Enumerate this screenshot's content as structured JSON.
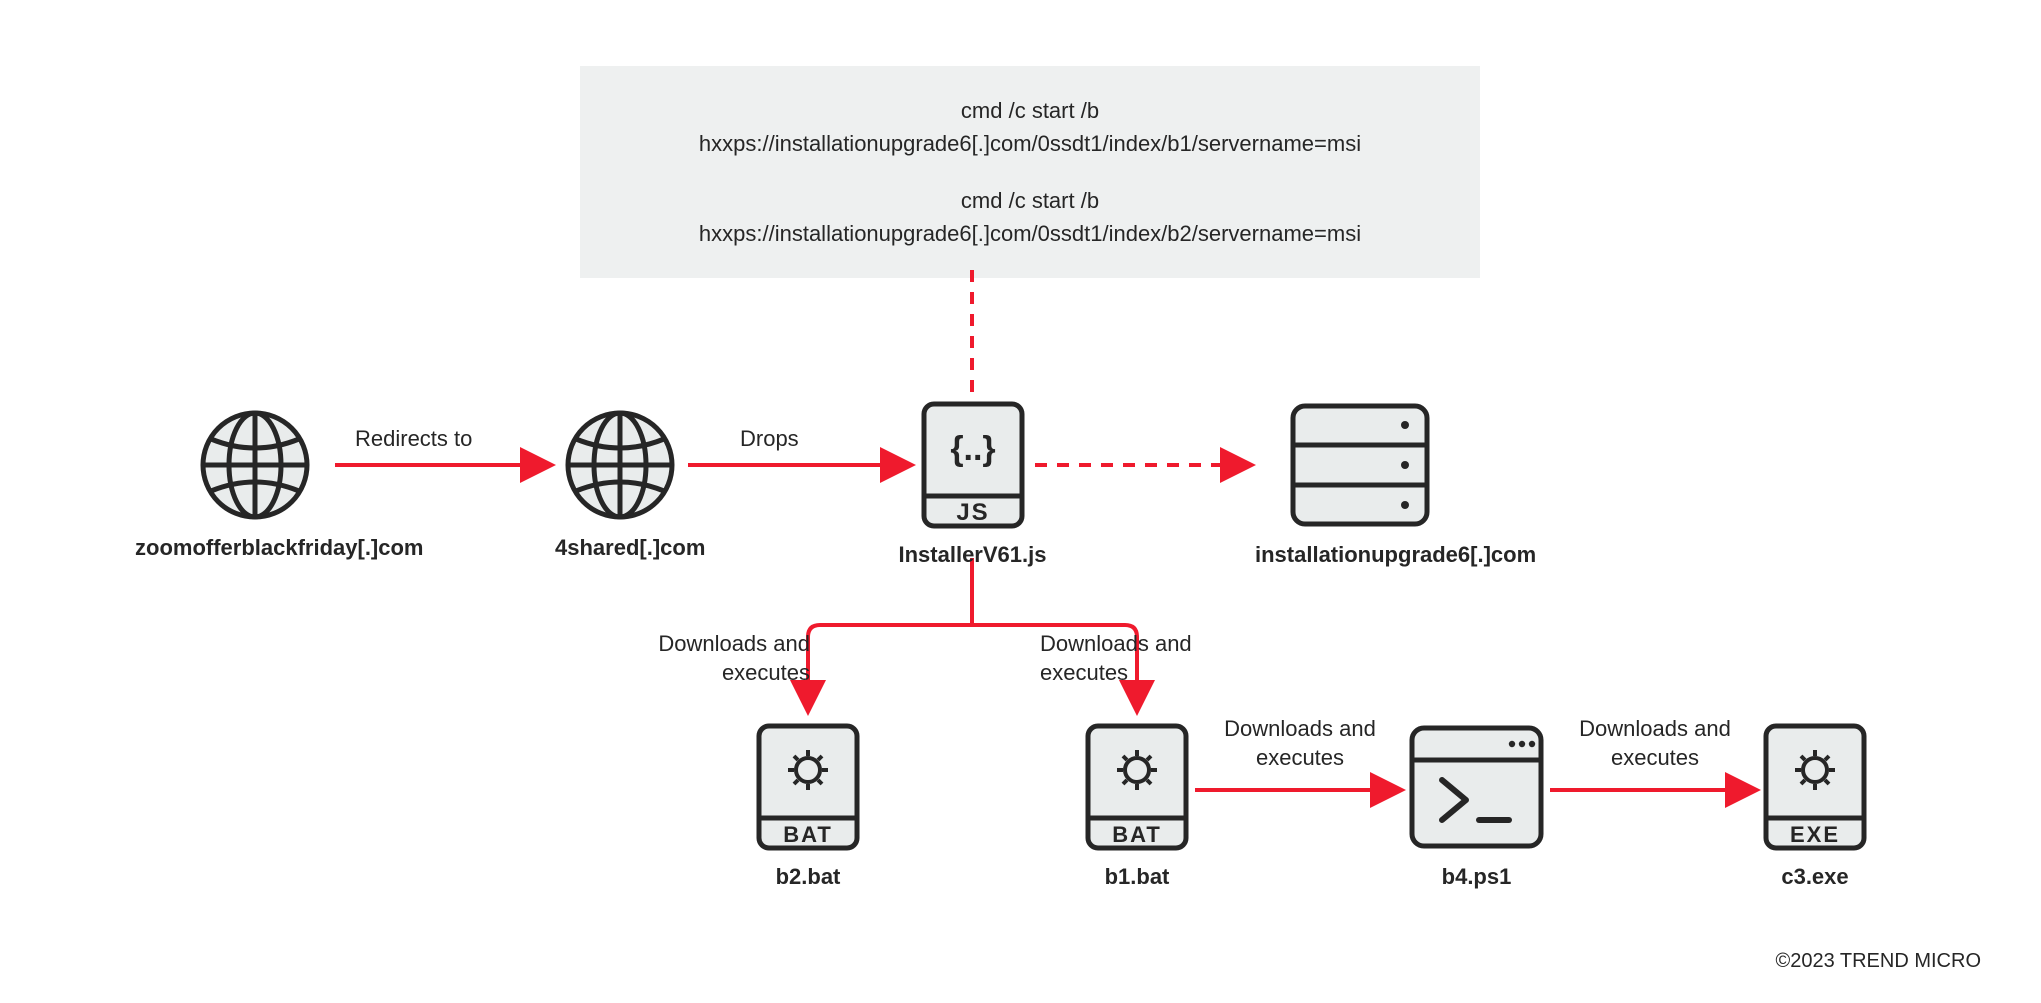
{
  "cmdbox": {
    "line1": "cmd /c start /b",
    "line2": "hxxps://installationupgrade6[.]com/0ssdt1/index/b1/servername=msi",
    "line3": "cmd /c start /b",
    "line4": "hxxps://installationupgrade6[.]com/0ssdt1/index/b2/servername=msi"
  },
  "nodes": {
    "globe1": {
      "label": "zoomofferblackfriday[.]com"
    },
    "globe2": {
      "label": "4shared[.]com"
    },
    "jsfile": {
      "label": "InstallerV61.js",
      "tag": "JS"
    },
    "server": {
      "label": "installationupgrade6[.]com"
    },
    "bat2": {
      "label": "b2.bat",
      "tag": "BAT"
    },
    "bat1": {
      "label": "b1.bat",
      "tag": "BAT"
    },
    "ps1": {
      "label": "b4.ps1"
    },
    "exe": {
      "label": "c3.exe",
      "tag": "EXE"
    }
  },
  "edges": {
    "redirects": "Redirects to",
    "drops": "Drops",
    "dl_exec": "Downloads and\nexecutes"
  },
  "copyright": "©2023 TREND MICRO"
}
